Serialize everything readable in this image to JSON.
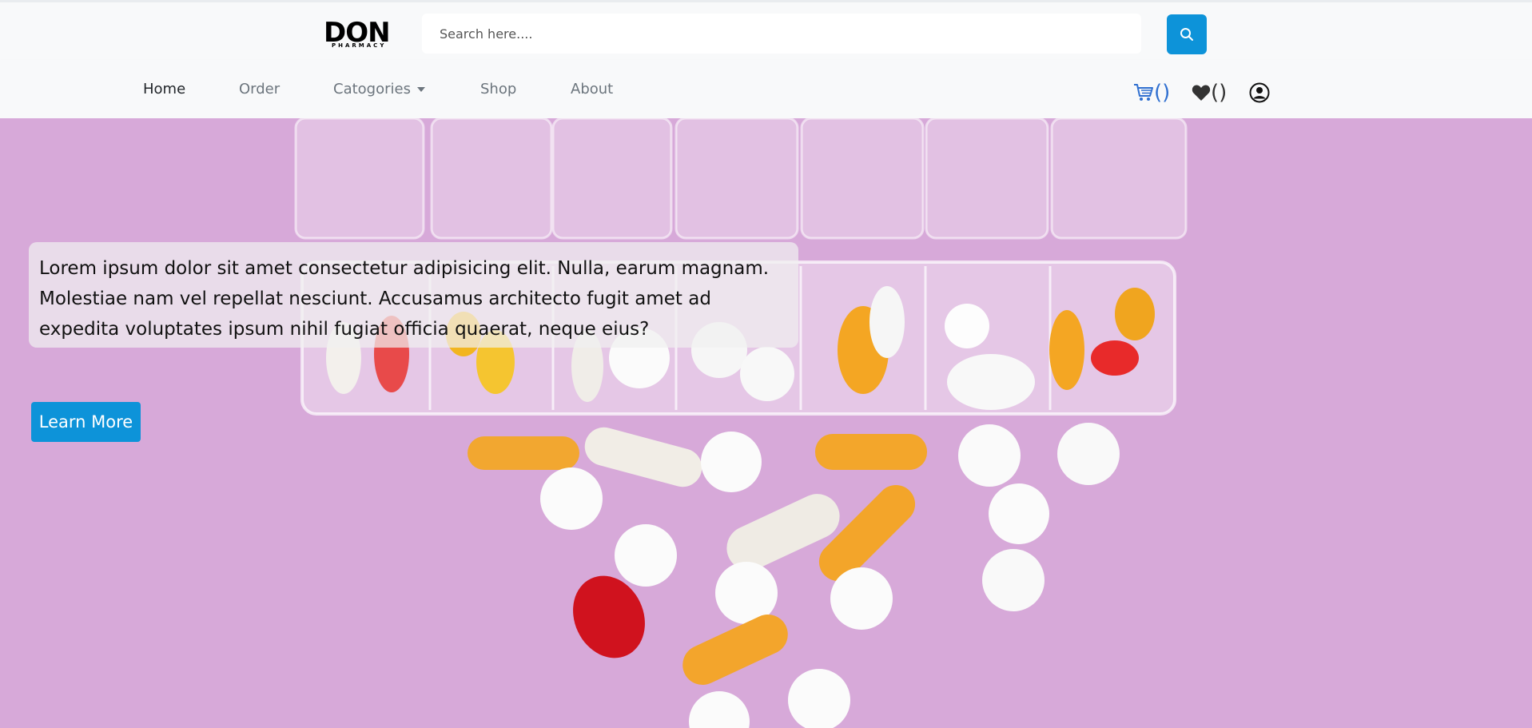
{
  "brand": {
    "name": "DON",
    "subtitle": "PHARMACY"
  },
  "search": {
    "placeholder": "Search here....",
    "value": "",
    "button_icon": "search-icon"
  },
  "nav": {
    "items": [
      {
        "label": "Home",
        "active": true
      },
      {
        "label": "Order",
        "active": false
      },
      {
        "label": "Catogories",
        "active": false,
        "dropdown": true
      },
      {
        "label": "Shop",
        "active": false
      },
      {
        "label": "About",
        "active": false
      }
    ],
    "cart": {
      "icon": "cart-icon",
      "count_text": "()"
    },
    "wishlist": {
      "icon": "heart-icon",
      "count_text": "()"
    },
    "account": {
      "icon": "user-icon"
    }
  },
  "hero": {
    "text": "Lorem ipsum dolor sit amet consectetur adipisicing elit. Nulla, earum magnam. Molestiae nam vel repellat nesciunt. Accusamus architecto fugit amet ad expedita voluptates ipsum nihil fugiat officia quaerat, neque eius?",
    "button_label": "Learn More"
  },
  "colors": {
    "accent": "#0d93d9",
    "background": "#f8f9fa",
    "hero_bg": "#d6a6d8",
    "cart_blue": "#2f6fd0"
  }
}
